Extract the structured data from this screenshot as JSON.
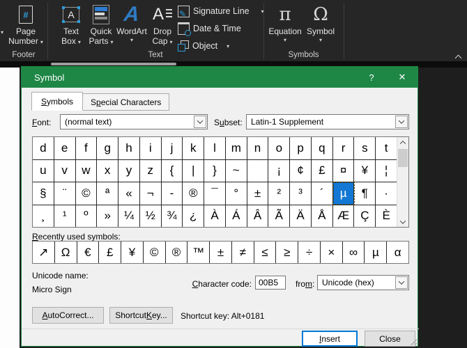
{
  "ribbon": {
    "groups": {
      "footer": "Footer",
      "text": "Text",
      "symbols": "Symbols"
    },
    "page_number": {
      "line1": "Page",
      "line2": "Number"
    },
    "text_box": {
      "line1": "Text",
      "line2": "Box"
    },
    "quick_parts": {
      "line1": "Quick",
      "line2": "Parts"
    },
    "wordart": {
      "label": "WordArt"
    },
    "drop_cap": {
      "line1": "Drop",
      "line2": "Cap"
    },
    "signature_line": "Signature Line",
    "date_time": "Date & Time",
    "object": "Object",
    "equation": "Equation",
    "symbol": "Symbol"
  },
  "dialog": {
    "title": "Symbol",
    "help_glyph": "?",
    "close_glyph": "✕",
    "tabs": [
      {
        "text": "Symbols",
        "u": 0,
        "active": true
      },
      {
        "text": "Special Characters",
        "u": 1,
        "active": false
      }
    ],
    "font_label": {
      "text": "Font:",
      "u": 0
    },
    "font_value": "(normal text)",
    "subset_label": {
      "text": "Subset:",
      "u": 1
    },
    "subset_value": "Latin-1 Supplement",
    "grid": {
      "rows": [
        [
          "d",
          "e",
          "f",
          "g",
          "h",
          "i",
          "j",
          "k",
          "l",
          "m",
          "n",
          "o",
          "p",
          "q",
          "r",
          "s",
          "t"
        ],
        [
          "u",
          "v",
          "w",
          "x",
          "y",
          "z",
          "{",
          "|",
          "}",
          "~",
          "",
          "¡",
          "¢",
          "£",
          "¤",
          "¥",
          "¦"
        ],
        [
          "§",
          "¨",
          "©",
          "ª",
          "«",
          "¬",
          "-",
          "®",
          "¯",
          "°",
          "±",
          "²",
          "³",
          "´",
          "µ",
          "¶",
          "·"
        ],
        [
          "¸",
          "¹",
          "º",
          "»",
          "¼",
          "½",
          "¾",
          "¿",
          "À",
          "Á",
          "Â",
          "Ã",
          "Ä",
          "Å",
          "Æ",
          "Ç",
          "È"
        ]
      ],
      "selected": {
        "row": 2,
        "col": 14
      }
    },
    "recent_label": {
      "text": "Recently used symbols:",
      "u": 0
    },
    "recent": [
      "↗",
      "Ω",
      "€",
      "£",
      "¥",
      "©",
      "®",
      "™",
      "±",
      "≠",
      "≤",
      "≥",
      "÷",
      "×",
      "∞",
      "µ",
      "α"
    ],
    "unicode_name_label": "Unicode name:",
    "unicode_name_value": "Micro Sign",
    "char_code_label": {
      "text": "Character code:",
      "u": 0
    },
    "char_code_value": "00B5",
    "from_label": {
      "text": "from:",
      "u": 3
    },
    "from_value": "Unicode (hex)",
    "autocorrect_button": {
      "text": "AutoCorrect...",
      "u": 0
    },
    "shortcut_key_button": {
      "text": "Shortcut Key...",
      "u": 9
    },
    "shortcut_key_text": "Shortcut key: Alt+0181",
    "insert_button": {
      "text": "Insert",
      "u": 0
    },
    "close_button": "Close",
    "accent_green": "#1e8745",
    "selection_blue": "#1278d4"
  }
}
